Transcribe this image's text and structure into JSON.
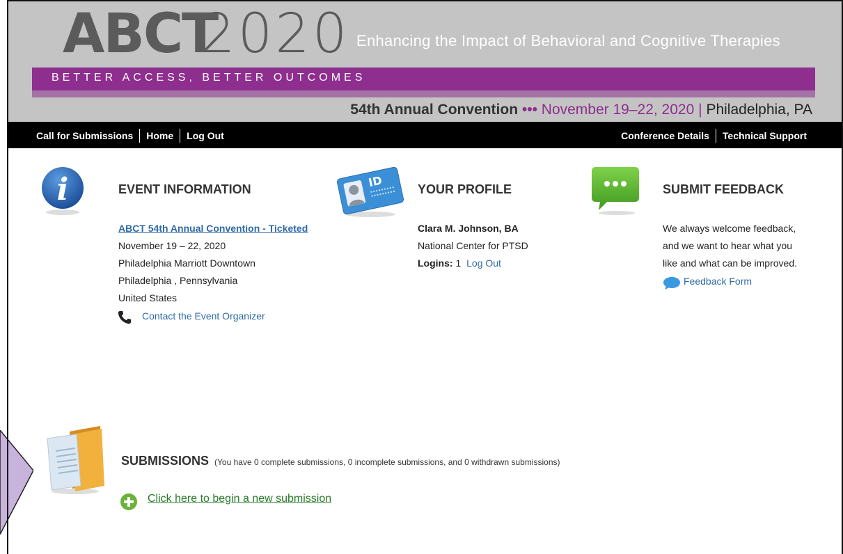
{
  "header": {
    "logo_abct": "ABCT",
    "logo_year": "2020",
    "tagline": "Enhancing the Impact of Behavioral and Cognitive Therapies",
    "motto": "BETTER ACCESS, BETTER OUTCOMES",
    "convention": {
      "annual": "54th Annual Convention",
      "dots": "•••",
      "dates": "November 19–22, 2020",
      "divider": "|",
      "place": "Philadelphia, PA"
    }
  },
  "nav": {
    "left": [
      "Call for Submissions",
      "Home",
      "Log Out"
    ],
    "right": [
      "Conference Details",
      "Technical Support"
    ]
  },
  "event": {
    "title": "EVENT INFORMATION",
    "name": "ABCT 54th Annual Convention - Ticketed",
    "dates": "November 19 – 22, 2020",
    "venue": "Philadelphia Marriott Downtown",
    "city": "Philadelphia , Pennsylvania",
    "country": "United States",
    "contact": "Contact the Event Organizer"
  },
  "profile": {
    "title": "YOUR PROFILE",
    "name": "Clara M. Johnson, BA",
    "org": "National Center for PTSD",
    "logins_label": "Logins:",
    "logins_value": "1",
    "logout": "Log Out"
  },
  "feedback": {
    "title": "SUBMIT FEEDBACK",
    "line1": "We always welcome feedback,",
    "line2": "and we want to hear what you",
    "line3": "like and what can be improved.",
    "form_link": "Feedback Form"
  },
  "submissions": {
    "title": "SUBMISSIONS",
    "note": "(You have 0 complete submissions, 0 incomplete submissions, and 0 withdrawn submissions)",
    "new_link": "Click here to begin a new submission"
  },
  "colors": {
    "purple": "#8e2e8e",
    "link": "#2f6aa6",
    "green_link": "#2a7a2a"
  }
}
